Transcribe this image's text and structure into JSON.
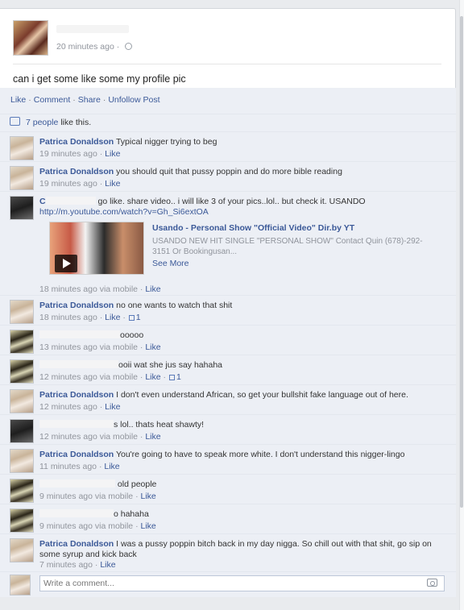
{
  "post": {
    "time": "20 minutes ago",
    "privacy_icon": "friends-icon",
    "text": "can i get some like some my profile pic"
  },
  "actions": {
    "like": "Like",
    "comment": "Comment",
    "share": "Share",
    "unfollow": "Unfollow Post",
    "separator": "·"
  },
  "likes": {
    "count_text": "7 people",
    "suffix": " like this."
  },
  "comments": [
    {
      "name": "Patrica Donaldson",
      "text": "Typical nigger trying to beg",
      "time": "19 minutes ago",
      "like": "Like"
    },
    {
      "name": "Patrica Donaldson",
      "text": "you should quit that pussy poppin and do more bible reading",
      "time": "19 minutes ago",
      "like": "Like"
    },
    {
      "name": "C",
      "text": "go like. share video.. i will like 3 of your pics..lol.. but check it. USANDO",
      "link": "http://m.youtube.com/watch?v=Gh_Si6extOA",
      "time": "18 minutes ago via mobile",
      "like": "Like",
      "share": {
        "title": "Usando - Personal Show \"Official Video\" Dir.by YT",
        "desc": "USANDO NEW HIT SINGLE \"PERSONAL SHOW\" Contact Quin (678)-292-3151 Or Bookingusan...",
        "more": "See More"
      }
    },
    {
      "name": "Patrica Donaldson",
      "text": "no one wants to watch that shit",
      "time": "18 minutes ago",
      "like": "Like",
      "like_count": "1"
    },
    {
      "name": "",
      "text": "ooooo",
      "time": "13 minutes ago via mobile",
      "like": "Like"
    },
    {
      "name": "",
      "text": "ooii wat she jus say hahaha",
      "time": "12 minutes ago via mobile",
      "like": "Like",
      "like_count": "1"
    },
    {
      "name": "Patrica Donaldson",
      "text": "I don't even understand African, so get your bullshit fake language out of here.",
      "time": "12 minutes ago",
      "like": "Like"
    },
    {
      "name": "",
      "text": "s lol.. thats heat shawty!",
      "time": "12 minutes ago via mobile",
      "like": "Like"
    },
    {
      "name": "Patrica Donaldson",
      "text": "You're going to have to speak more white. I don't understand this nigger-lingo",
      "time": "11 minutes ago",
      "like": "Like"
    },
    {
      "name": "",
      "text": "old people",
      "time": "9 minutes ago via mobile",
      "like": "Like"
    },
    {
      "name": "",
      "text": "o hahaha",
      "time": "9 minutes ago via mobile",
      "like": "Like"
    },
    {
      "name": "Patrica Donaldson",
      "text": "I was a pussy poppin bitch back in my day nigga. So chill out with that shit, go sip on some syrup and kick back",
      "time": "7 minutes ago",
      "like": "Like"
    }
  ],
  "write_comment": {
    "placeholder": "Write a comment...",
    "camera_icon": "camera-icon"
  }
}
